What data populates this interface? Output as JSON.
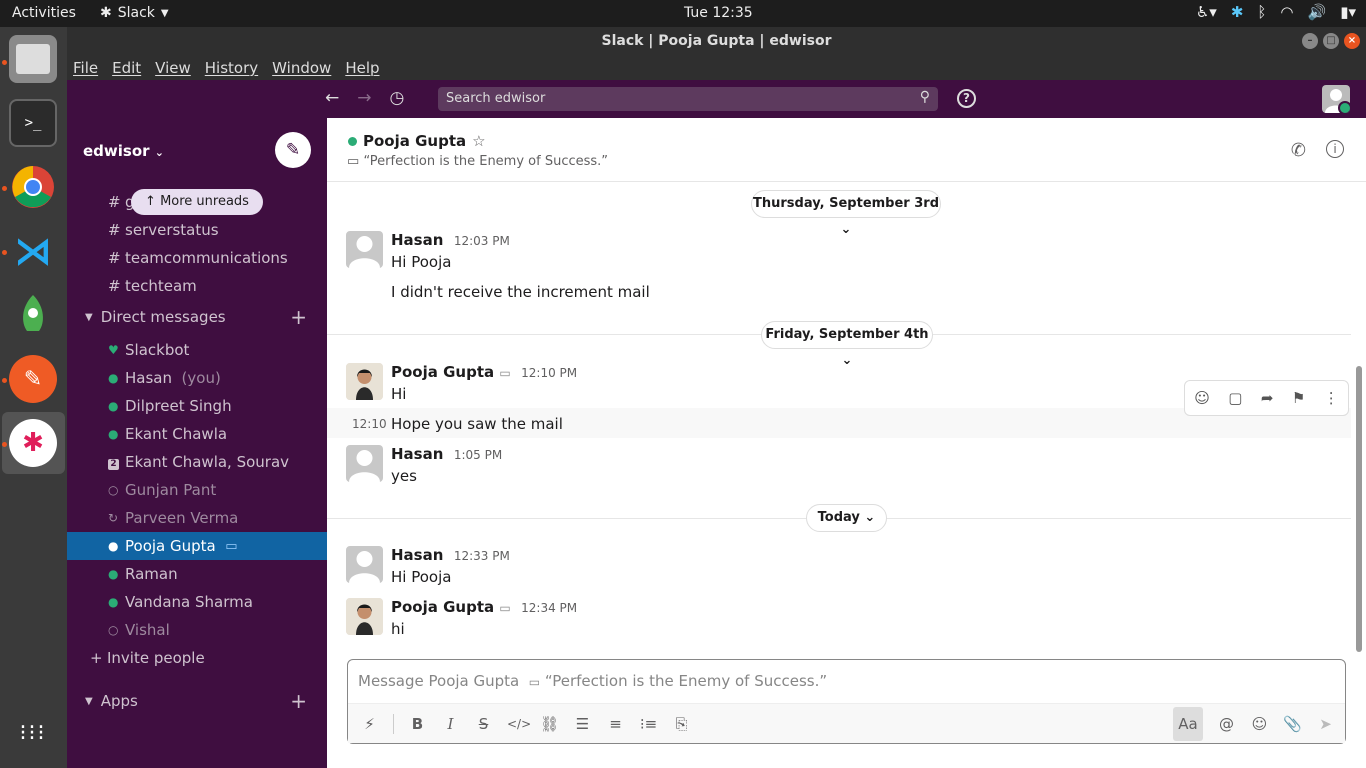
{
  "system": {
    "activities": "Activities",
    "app_name": "Slack",
    "clock": "Tue 12:35"
  },
  "window": {
    "title": "Slack | Pooja Gupta | edwisor",
    "menu": [
      "File",
      "Edit",
      "View",
      "History",
      "Window",
      "Help"
    ]
  },
  "search": {
    "placeholder": "Search edwisor"
  },
  "sidebar": {
    "workspace": "edwisor",
    "more_unreads": "More unreads",
    "channels": [
      "general",
      "serverstatus",
      "teamcommunications",
      "techteam"
    ],
    "direct_messages_header": "Direct messages",
    "dms": [
      {
        "name": "Slackbot",
        "status": "bot"
      },
      {
        "name": "Hasan",
        "suffix": "(you)",
        "status": "online"
      },
      {
        "name": "Dilpreet Singh",
        "status": "online"
      },
      {
        "name": "Ekant Chawla",
        "status": "online"
      },
      {
        "name": "Ekant Chawla, Sourav",
        "status": "group",
        "badge": "2"
      },
      {
        "name": "Gunjan Pant",
        "status": "away"
      },
      {
        "name": "Parveen Verma",
        "status": "away"
      },
      {
        "name": "Pooja Gupta",
        "status": "online",
        "selected": true
      },
      {
        "name": "Raman",
        "status": "online"
      },
      {
        "name": "Vandana Sharma",
        "status": "online"
      },
      {
        "name": "Vishal",
        "status": "away"
      }
    ],
    "invite": "Invite people",
    "apps_header": "Apps"
  },
  "channel": {
    "name": "Pooja Gupta",
    "status_text": "“Perfection is the Enemy of Success.”"
  },
  "dates": {
    "d1": "Thursday, September 3rd",
    "d2": "Friday, September 4th",
    "d3": "Today"
  },
  "messages": [
    {
      "author": "Hasan",
      "time": "12:03 PM",
      "lines": [
        "Hi Pooja",
        "I didn't receive the increment mail"
      ]
    },
    {
      "author": "Pooja Gupta",
      "time": "12:10 PM",
      "lines": [
        "Hi"
      ]
    },
    {
      "continuation_time": "12:10",
      "lines": [
        "Hope you saw the mail"
      ]
    },
    {
      "author": "Hasan",
      "time": "1:05 PM",
      "lines": [
        "yes"
      ]
    },
    {
      "author": "Hasan",
      "time": "12:33 PM",
      "lines": [
        "Hi Pooja"
      ]
    },
    {
      "author": "Pooja Gupta",
      "time": "12:34 PM",
      "lines": [
        "hi"
      ]
    }
  ],
  "composer": {
    "placeholder": "Message Pooja Gupta",
    "status_hint": "“Perfection is the Enemy of Success.”",
    "format_label": "Aa"
  },
  "colors": {
    "aubergine": "#3f0e40",
    "selected": "#1164a3",
    "online": "#2bac76"
  }
}
